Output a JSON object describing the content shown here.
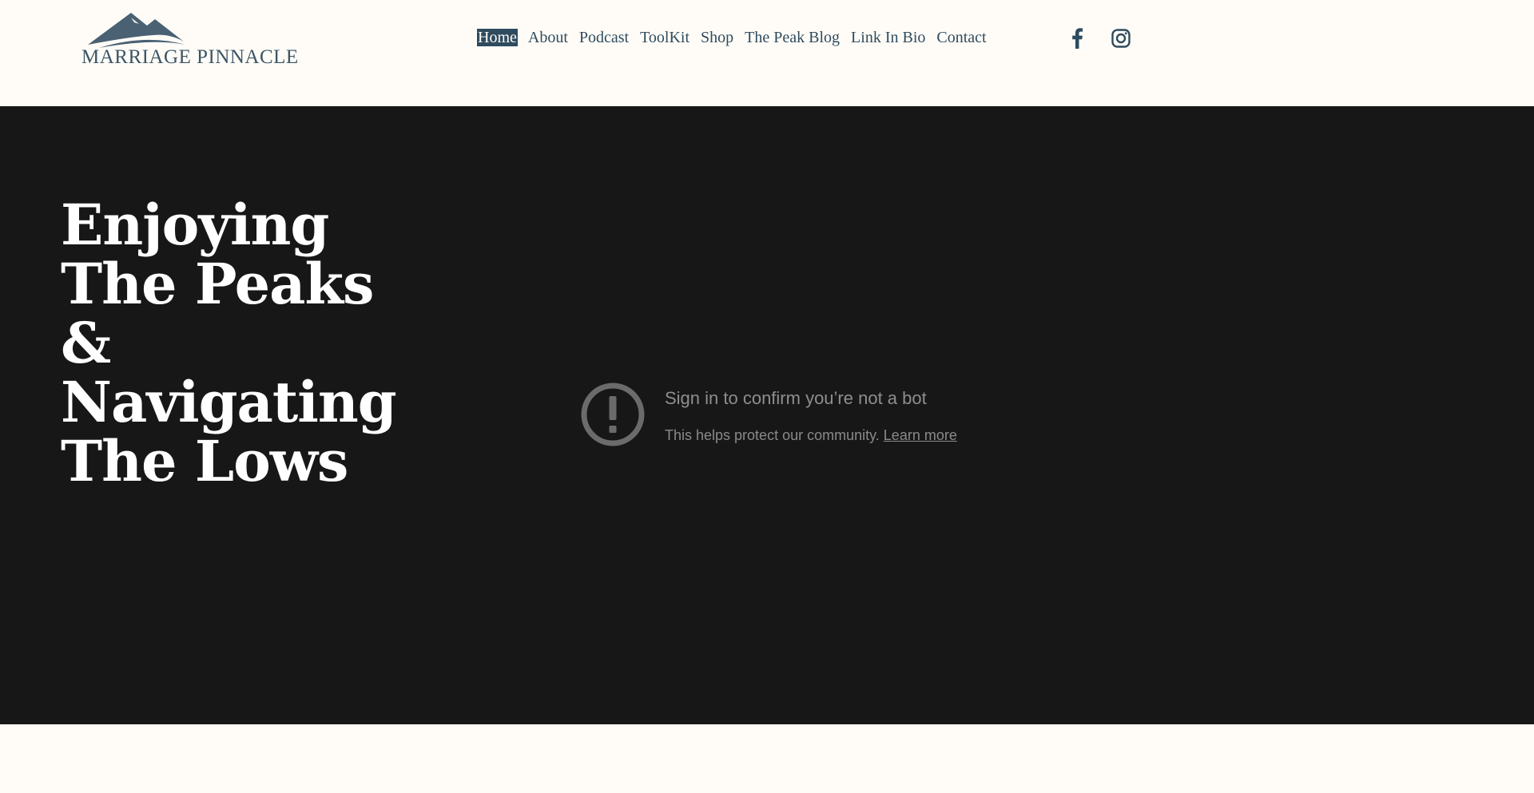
{
  "brand": {
    "logo_text": "MARRIAGE PINNACLE",
    "color": "#3c5566"
  },
  "nav": {
    "items": [
      {
        "label": "Home",
        "active": true
      },
      {
        "label": "About"
      },
      {
        "label": "Podcast"
      },
      {
        "label": "ToolKit"
      },
      {
        "label": "Shop"
      },
      {
        "label": "The Peak Blog"
      },
      {
        "label": "Link In Bio"
      },
      {
        "label": "Contact"
      }
    ],
    "text_color": "#2f4b5e"
  },
  "social": {
    "icons": [
      "facebook-icon",
      "instagram-icon"
    ]
  },
  "hero": {
    "title": "Enjoying The Peaks & Navigating The Lows",
    "background": "#171717"
  },
  "video_notice": {
    "icon": "alert-circle-icon",
    "title": "Sign in to confirm you’re not a bot",
    "message": "This helps protect our community.",
    "link_label": "Learn more"
  }
}
